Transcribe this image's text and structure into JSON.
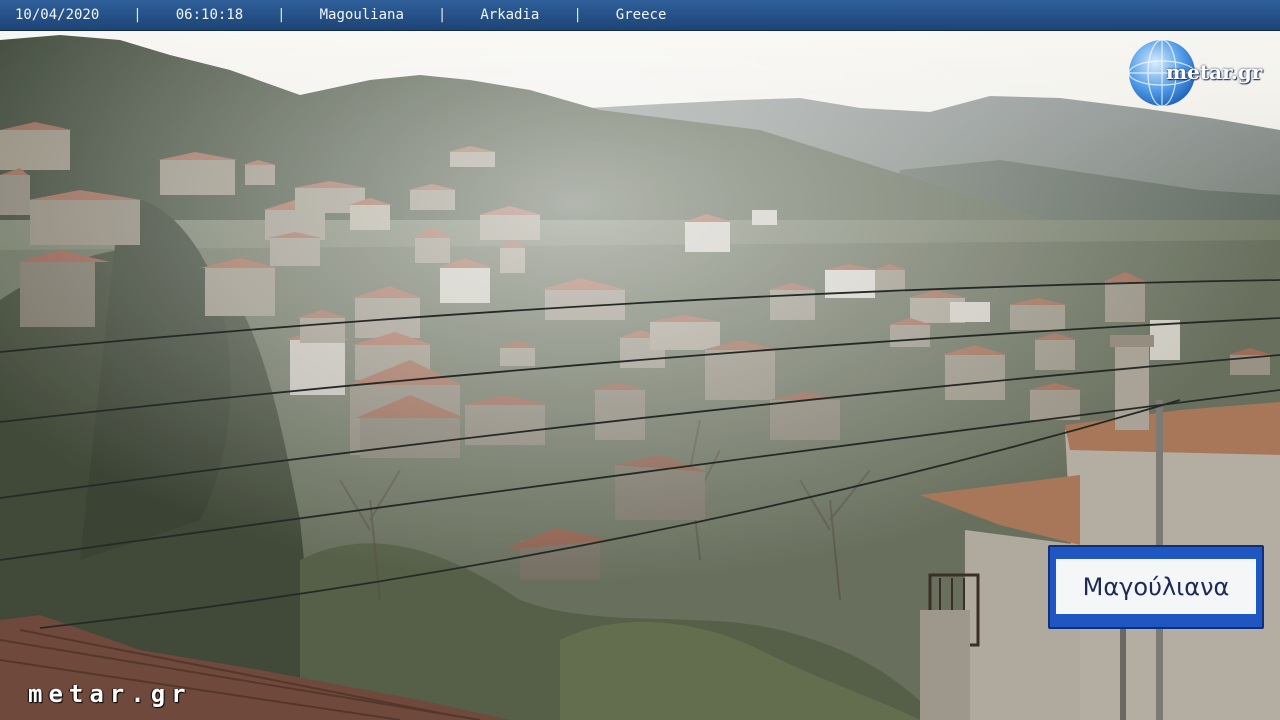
{
  "overlay": {
    "date": "10/04/2020",
    "time": "06:10:18",
    "village": "Magouliana",
    "region": "Arkadia",
    "country": "Greece",
    "separator": "|"
  },
  "logo": {
    "text": "metar.gr",
    "icon": "globe-icon"
  },
  "watermark": "metar.gr",
  "sign": {
    "text": "Μαγούλιανα"
  },
  "colors": {
    "bar": "#254f86",
    "sign_blue": "#1f56c2"
  }
}
